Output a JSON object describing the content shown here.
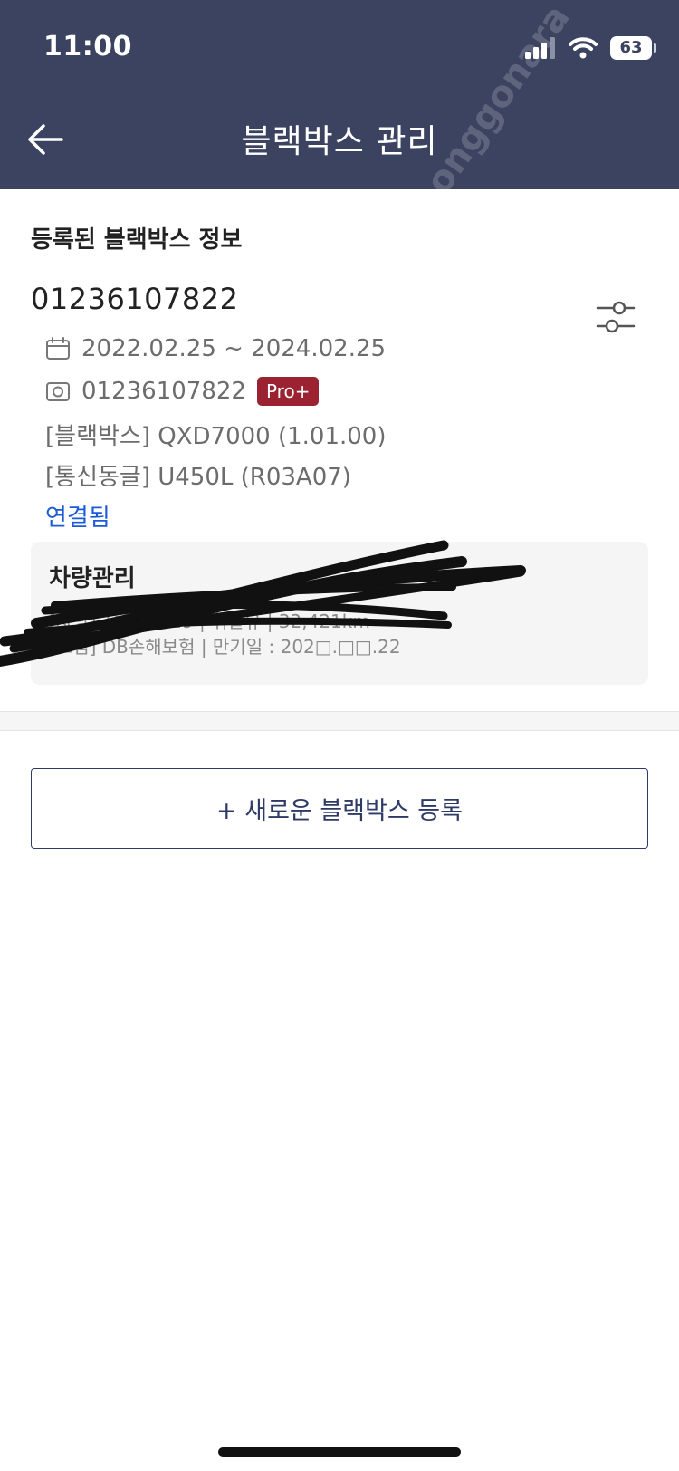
{
  "status_bar": {
    "time": "11:00",
    "battery": "63"
  },
  "header": {
    "title": "블랙박스 관리"
  },
  "section": {
    "title": "등록된 블랙박스 정보"
  },
  "device": {
    "id": "01236107822",
    "period": "2022.02.25 ~ 2024.02.25",
    "serial": "01236107822",
    "badge": "Pro+",
    "blackbox": "[블랙박스] QXD7000 (1.01.00)",
    "dongle": "[통신동글] U450L (R03A07)",
    "connection_status": "연결됨"
  },
  "vehicle": {
    "title": "차량관리",
    "line1": "[차량] 1□루4829 | 휘발유 | 32,421km",
    "line2": "[보험] DB손해보험 | 만기일 : 202□.□□.22"
  },
  "actions": {
    "add_label": "+ 새로운 블랙박스 등록"
  },
  "watermark": "joonggonara",
  "colors": {
    "header_bg": "#3b4360",
    "badge_bg": "#9b2331",
    "link": "#1d5bd6",
    "button_border": "#2e3a66"
  },
  "icons": [
    "back-arrow-icon",
    "signal-icon",
    "wifi-icon",
    "calendar-icon",
    "camera-icon",
    "sliders-icon"
  ]
}
